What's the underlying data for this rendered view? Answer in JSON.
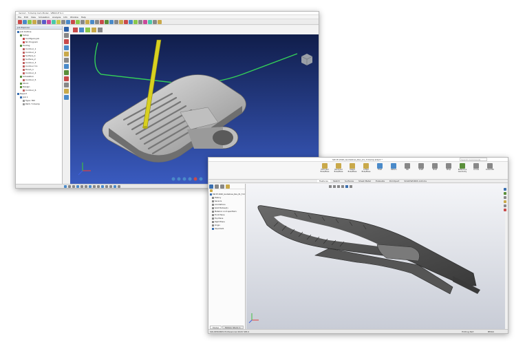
{
  "app1": {
    "title": "Vericut - T-Clamp Cam Model - VERICUT 9.1",
    "menu": [
      "File",
      "Edit",
      "View",
      "Simulation",
      "Analysis",
      "Info",
      "Window",
      "Help"
    ],
    "tree_tab": "Job Explorer",
    "tree": [
      {
        "label": "Job Outline",
        "indent": 0,
        "icon": "#3a6fb0"
      },
      {
        "label": "Setup",
        "indent": 1,
        "icon": "#5a8f3a"
      },
      {
        "label": "Configure Job",
        "indent": 2,
        "icon": "#c94a4a"
      },
      {
        "label": "NC Program",
        "indent": 2,
        "icon": "#c94a4a"
      },
      {
        "label": "Tooling",
        "indent": 1,
        "icon": "#5a8f3a"
      },
      {
        "label": "Contour_1",
        "indent": 2,
        "icon": "#c06060"
      },
      {
        "label": "Contour_2",
        "indent": 2,
        "icon": "#c06060"
      },
      {
        "label": "Surface_1",
        "indent": 2,
        "icon": "#c06060"
      },
      {
        "label": "Surface_2",
        "indent": 2,
        "icon": "#c06060"
      },
      {
        "label": "Contour_3",
        "indent": 2,
        "icon": "#c06060"
      },
      {
        "label": "Contour 3.1",
        "indent": 2,
        "icon": "#c06060"
      },
      {
        "label": "Finish_1",
        "indent": 2,
        "icon": "#c06060"
      },
      {
        "label": "Contour_4",
        "indent": 2,
        "icon": "#c06060"
      },
      {
        "label": "Simulation",
        "indent": 1,
        "icon": "#5a8f3a"
      },
      {
        "label": "Contour_5",
        "indent": 2,
        "icon": "#c06060"
      },
      {
        "label": "Stock",
        "indent": 1,
        "icon": "#5a8f3a"
      },
      {
        "label": "Design",
        "indent": 1,
        "icon": "#5a8f3a"
      },
      {
        "label": "Contour_6",
        "indent": 2,
        "icon": "#c06060"
      },
      {
        "label": "Report",
        "indent": 0,
        "icon": "#3a6fb0"
      },
      {
        "label": "Job 1",
        "indent": 1,
        "icon": "#3a6fb0"
      },
      {
        "label": "Type: Mill",
        "indent": 2,
        "icon": "#999999"
      },
      {
        "label": "Path: T-Clamp",
        "indent": 2,
        "icon": "#999999"
      }
    ],
    "status": [
      "Tracking",
      "1.000",
      "0.000",
      "4.000",
      "100.0%"
    ]
  },
  "app2": {
    "title": "SW Pt 2020_Guidelines_Rev_01_T-Clamp.sldprt *",
    "search_placeholder": "Search Commands",
    "ribbon_tabs": [
      "Features",
      "Sketch",
      "Surfaces",
      "Sheet Metal",
      "Evaluate",
      "DimXpert",
      "SOLIDWORKS Add-Ins"
    ],
    "ribbon_groups": [
      "Extruded Boss/Base",
      "Revolved Boss/Base",
      "Swept Boss/Base",
      "Lofted Boss/Base",
      "Fillet",
      "Pattern",
      "Rib",
      "Draft",
      "Shell",
      "Wrap",
      "Reference Geometry",
      "Curves",
      "Instant3D"
    ],
    "tree": [
      {
        "label": "SW Pt 2020_Guidelines_Rev_01_T-Clamp",
        "icon": "#3a6fb0"
      },
      {
        "label": "History",
        "icon": "#888888"
      },
      {
        "label": "Sensors",
        "icon": "#888888"
      },
      {
        "label": "Annotations",
        "icon": "#888888"
      },
      {
        "label": "Solid Bodies(1)",
        "icon": "#888888"
      },
      {
        "label": "Material <not specified>",
        "icon": "#888888"
      },
      {
        "label": "Front Plane",
        "icon": "#888888"
      },
      {
        "label": "Top Plane",
        "icon": "#888888"
      },
      {
        "label": "Right Plane",
        "icon": "#888888"
      },
      {
        "label": "Origin",
        "icon": "#888888"
      },
      {
        "label": "Imported1",
        "icon": "#3a6fb0"
      }
    ],
    "bottom_tabs": [
      "Model",
      "Motion Study 1"
    ],
    "status": [
      "SOLIDWORKS Professional 2020 SP4.0",
      "Editing Part",
      "MMGS"
    ]
  },
  "colors": {
    "vp_top": "#0e1a44",
    "vp_bottom": "#3a5bc0",
    "tool": "#d8d020",
    "part_dark": "#4a4a4a",
    "sw_bg_top": "#f4f5f8",
    "sw_bg_bottom": "#c8ccd6"
  },
  "icons": [
    "view-cube-icon",
    "axis-triad-icon",
    "search-icon",
    "gear-icon",
    "zoom-icon",
    "rotate-icon"
  ]
}
